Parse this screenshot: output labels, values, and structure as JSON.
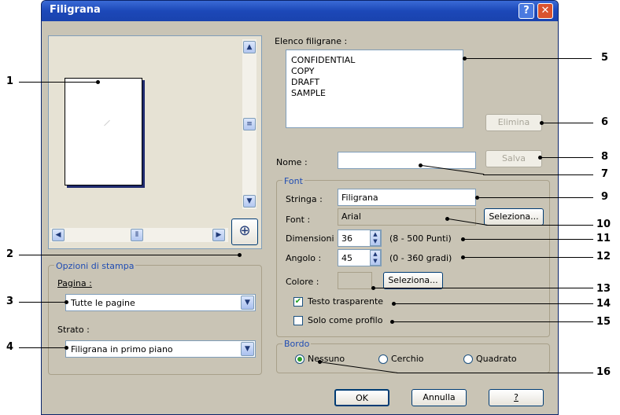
{
  "window": {
    "title": "Filigrana",
    "help_glyph": "?",
    "close_glyph": "✕"
  },
  "watermark_list": {
    "label": "Elenco filigrane :",
    "items": [
      "CONFIDENTIAL",
      "COPY",
      "DRAFT",
      "SAMPLE"
    ],
    "delete_button": "Elimina"
  },
  "name": {
    "label": "Nome :",
    "value": "",
    "save_button": "Salva"
  },
  "font_group": {
    "title": "Font",
    "string_label": "Stringa :",
    "string_value": "Filigrana",
    "font_label": "Font :",
    "font_value": "Arial",
    "font_select_button": "Seleziona...",
    "size_label": "Dimensioni :",
    "size_value": "36",
    "size_range": "(8 - 500 Punti)",
    "angle_label": "Angolo :",
    "angle_value": "45",
    "angle_range": "(0 - 360 gradi)",
    "color_label": "Colore :",
    "color_value": "#c9c4b5",
    "color_select_button": "Seleziona...",
    "transparent_label": "Testo trasparente",
    "transparent_checked": true,
    "outline_label": "Solo come profilo",
    "outline_checked": false
  },
  "border_group": {
    "title": "Bordo",
    "options": [
      "Nessuno",
      "Cerchio",
      "Quadrato"
    ],
    "selected": "Nessuno"
  },
  "print_options": {
    "title": "Opzioni di stampa",
    "page_label": "Pagina :",
    "page_value": "Tutte le pagine",
    "layer_label": "Strato :",
    "layer_value": "Filigrana in primo piano"
  },
  "footer": {
    "ok": "OK",
    "cancel": "Annulla",
    "help": "?"
  },
  "callouts": [
    "1",
    "2",
    "3",
    "4",
    "5",
    "6",
    "7",
    "8",
    "9",
    "10",
    "11",
    "12",
    "13",
    "14",
    "15",
    "16"
  ]
}
